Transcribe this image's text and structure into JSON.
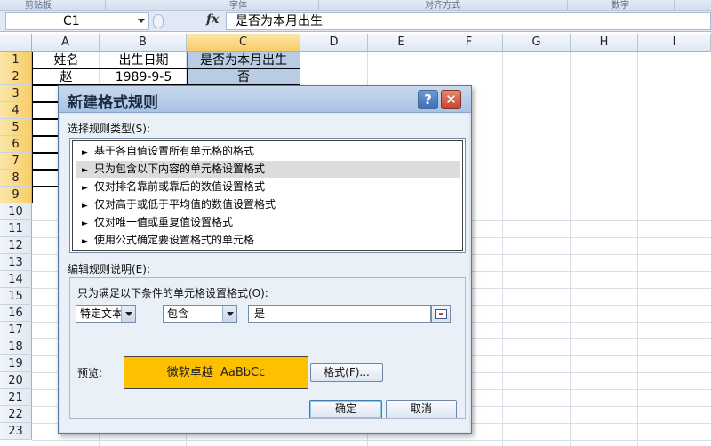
{
  "ribbon": {
    "groups": [
      "剪贴板",
      "字体",
      "对齐方式",
      "数字"
    ]
  },
  "formula_bar": {
    "name_box": "C1",
    "fx_label": "fx",
    "content": "是否为本月出生"
  },
  "sheet": {
    "columns": [
      "A",
      "B",
      "C",
      "D",
      "E",
      "F",
      "G",
      "H",
      "I"
    ],
    "rows": [
      "1",
      "2",
      "3",
      "4",
      "5",
      "6",
      "7",
      "8",
      "9",
      "10",
      "11",
      "12",
      "13",
      "14",
      "15",
      "16",
      "17",
      "18",
      "19",
      "20",
      "21",
      "22",
      "23"
    ],
    "cells": {
      "a1": "姓名",
      "b1": "出生日期",
      "c1": "是否为本月出生",
      "a2": "赵",
      "b2": "1989-9-5",
      "c2": "否"
    }
  },
  "dialog": {
    "title": "新建格式规则",
    "help_label": "?",
    "close_label": "✕",
    "rule_type_label": "选择规则类型(S):",
    "rule_types": [
      "基于各自值设置所有单元格的格式",
      "只为包含以下内容的单元格设置格式",
      "仅对排名靠前或靠后的数值设置格式",
      "仅对高于或低于平均值的数值设置格式",
      "仅对唯一值或重复值设置格式",
      "使用公式确定要设置格式的单元格"
    ],
    "selected_rule_index": 1,
    "desc_label": "编辑规则说明(E):",
    "condition_label": "只为满足以下条件的单元格设置格式(O):",
    "condition_type": "特定文本",
    "operator": "包含",
    "value": "是",
    "preview_label": "预览:",
    "preview_text": "微软卓越  AaBbCc",
    "preview_color": "#FFC000",
    "format_button": "格式(F)...",
    "ok_button": "确定",
    "cancel_button": "取消"
  }
}
